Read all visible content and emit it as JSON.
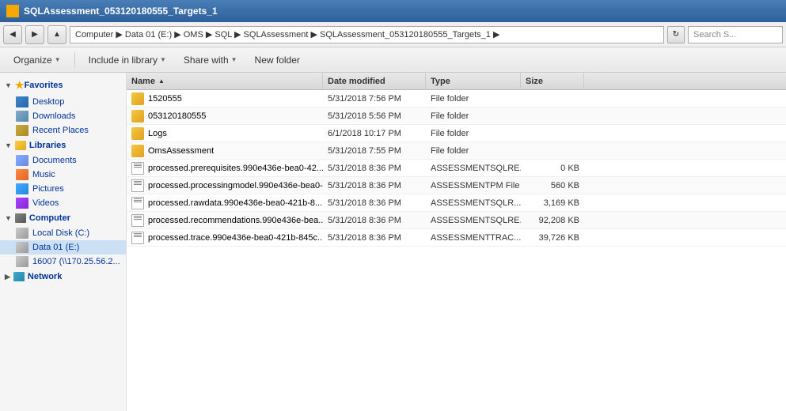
{
  "titleBar": {
    "title": "SQLAssessment_053120180555_Targets_1"
  },
  "addressBar": {
    "path": "Computer ▶ Data 01 (E:) ▶ OMS ▶ SQL ▶ SQLAssessment ▶ SQLAssessment_053120180555_Targets_1 ▶",
    "searchPlaceholder": "Search S..."
  },
  "toolbar": {
    "organizeLabel": "Organize",
    "includeLabel": "Include in library",
    "shareLabel": "Share with",
    "newFolderLabel": "New folder"
  },
  "sidebar": {
    "favorites": {
      "header": "Favorites",
      "items": [
        {
          "label": "Desktop",
          "iconClass": "icon-desktop"
        },
        {
          "label": "Downloads",
          "iconClass": "icon-downloads"
        },
        {
          "label": "Recent Places",
          "iconClass": "icon-recent"
        }
      ]
    },
    "libraries": {
      "header": "Libraries",
      "items": [
        {
          "label": "Documents",
          "iconClass": "icon-documents"
        },
        {
          "label": "Music",
          "iconClass": "icon-music"
        },
        {
          "label": "Pictures",
          "iconClass": "icon-pictures"
        },
        {
          "label": "Videos",
          "iconClass": "icon-videos"
        }
      ]
    },
    "computer": {
      "header": "Computer",
      "items": [
        {
          "label": "Local Disk (C:)",
          "iconClass": "icon-disk"
        },
        {
          "label": "Data 01 (E:)",
          "iconClass": "icon-disk",
          "selected": true
        },
        {
          "label": "16007 (\\\\170.25.56.2...",
          "iconClass": "icon-disk"
        }
      ]
    },
    "network": {
      "header": "Network"
    }
  },
  "fileList": {
    "columns": [
      {
        "label": "Name",
        "sortArrow": "▲",
        "class": "col-name"
      },
      {
        "label": "Date modified",
        "class": "col-date"
      },
      {
        "label": "Type",
        "class": "col-type"
      },
      {
        "label": "Size",
        "class": "col-size"
      }
    ],
    "rows": [
      {
        "name": "1520555",
        "date": "5/31/2018 7:56 PM",
        "type": "File folder",
        "size": "",
        "iconType": "folder"
      },
      {
        "name": "053120180555",
        "date": "5/31/2018 5:56 PM",
        "type": "File folder",
        "size": "",
        "iconType": "folder"
      },
      {
        "name": "Logs",
        "date": "6/1/2018 10:17 PM",
        "type": "File folder",
        "size": "",
        "iconType": "folder"
      },
      {
        "name": "OmsAssessment",
        "date": "5/31/2018 7:55 PM",
        "type": "File folder",
        "size": "",
        "iconType": "folder"
      },
      {
        "name": "processed.prerequisites.990e436e-bea0-42...",
        "date": "5/31/2018 8:36 PM",
        "type": "ASSESSMENTSQLRE...",
        "size": "0 KB",
        "iconType": "file"
      },
      {
        "name": "processed.processingmodel.990e436e-bea0-...",
        "date": "5/31/2018 8:36 PM",
        "type": "ASSESSMENTPM File",
        "size": "560 KB",
        "iconType": "file"
      },
      {
        "name": "processed.rawdata.990e436e-bea0-421b-8...",
        "date": "5/31/2018 8:36 PM",
        "type": "ASSESSMENTSQLR...",
        "size": "3,169 KB",
        "iconType": "file"
      },
      {
        "name": "processed.recommendations.990e436e-bea...",
        "date": "5/31/2018 8:36 PM",
        "type": "ASSESSMENTSQLRE...",
        "size": "92,208 KB",
        "iconType": "file"
      },
      {
        "name": "processed.trace.990e436e-bea0-421b-845c...",
        "date": "5/31/2018 8:36 PM",
        "type": "ASSESSMENTTRAC...",
        "size": "39,726 KB",
        "iconType": "file"
      }
    ]
  }
}
